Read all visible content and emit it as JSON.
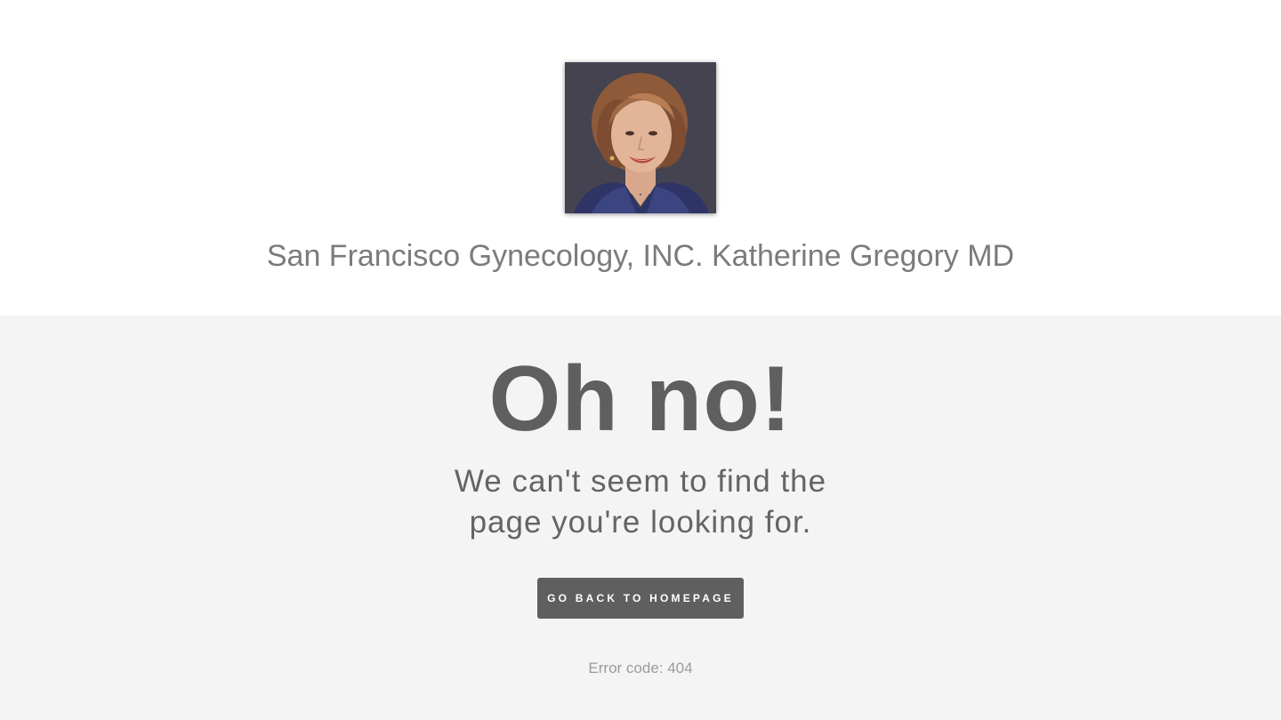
{
  "header": {
    "avatar_alt": "Katherine Gregory MD portrait",
    "site_title": "San Francisco Gynecology, INC. Katherine Gregory MD"
  },
  "error": {
    "headline": "Oh no!",
    "message_line1": "We can't seem to find the",
    "message_line2": "page you're looking for.",
    "button_label": "GO BACK TO HOMEPAGE",
    "code_text": "Error code: 404"
  },
  "colors": {
    "header_background": "#ffffff",
    "panel_background": "#f4f4f4",
    "button_background": "#5f5f5f",
    "headline_text": "#5f5f5f",
    "title_text": "#7b7b7b"
  }
}
